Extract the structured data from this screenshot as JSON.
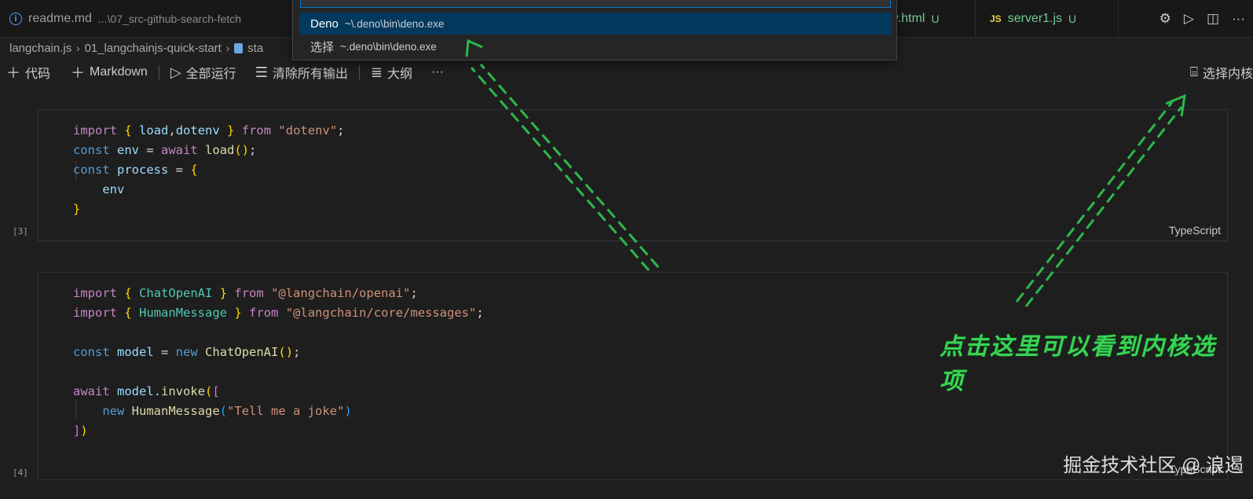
{
  "tabs": [
    {
      "name": "readme.md",
      "path": "...\\07_src-github-search-fetch"
    },
    {
      "name": "y.html",
      "badge": "U"
    },
    {
      "name": "server1.js",
      "badge": "U",
      "icon_text": "JS"
    }
  ],
  "breadcrumb": {
    "items": [
      "langchain.js",
      "01_langchainjs-quick-start",
      "sta"
    ]
  },
  "toolbar": {
    "add_code": "代码",
    "add_markdown": "Markdown",
    "run_all": "全部运行",
    "clear_outputs": "清除所有输出",
    "outline": "大纲",
    "more": "···",
    "select_kernel": "选择内核"
  },
  "quickpick": {
    "items": [
      {
        "label": "Deno",
        "desc": "~\\.deno\\bin\\deno.exe"
      },
      {
        "label": "选择",
        "desc": "~.deno\\bin\\deno.exe"
      }
    ]
  },
  "cells": [
    {
      "exec_count": "[3]",
      "language": "TypeScript"
    },
    {
      "exec_count": "[4]",
      "language": "TypeScript"
    }
  ],
  "annotation": {
    "line1": "点击这里可以看到内核选",
    "line2": "项"
  },
  "watermark": "掘金技术社区 @ 浪遏",
  "colors": {
    "accent": "#0078d4",
    "selection": "#04395e",
    "annotation": "#39d353"
  }
}
